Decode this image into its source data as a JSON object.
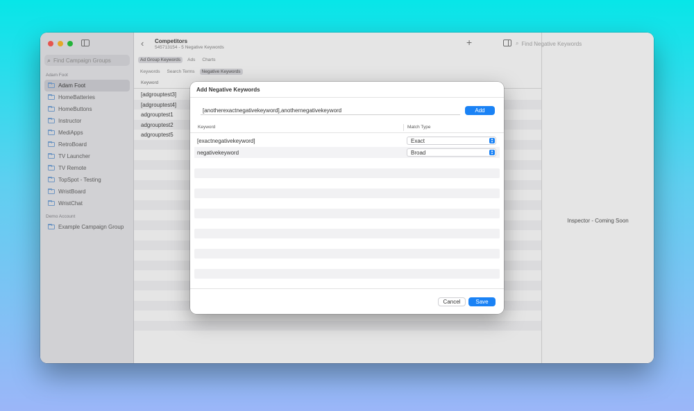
{
  "sidebar": {
    "search_placeholder": "Find Campaign Groups",
    "sections": [
      {
        "title": "Adam Foot",
        "items": [
          "Adam Foot",
          "HomeBatteries",
          "HomeButtons",
          "Instructor",
          "MediApps",
          "RetroBoard",
          "TV Launcher",
          "TV Remote",
          "TopSpot - Testing",
          "WristBoard",
          "WristChat"
        ]
      },
      {
        "title": "Demo Account",
        "items": [
          "Example Campaign Group"
        ]
      }
    ]
  },
  "header": {
    "title": "Competitors",
    "subtitle": "545713154 - 5 Negative Keywords",
    "search_placeholder": "Find Negative Keywords"
  },
  "segments": {
    "row1": [
      "Ad Group Keywords",
      "Ads",
      "Charts"
    ],
    "row2": [
      "Keywords",
      "Search Terms",
      "Negative Keywords"
    ]
  },
  "table": {
    "column_keyword": "Keyword",
    "rows": [
      {
        "keyword": "[adgrouptest3]",
        "right": "up"
      },
      {
        "keyword": "[adgrouptest4]",
        "right": "up"
      },
      {
        "keyword": "adgrouptest1",
        "right": "up"
      },
      {
        "keyword": "adgrouptest2",
        "right": "up"
      },
      {
        "keyword": "adgrouptest5",
        "right": "up"
      }
    ]
  },
  "inspector": {
    "text": "Inspector - Coming Soon"
  },
  "dialog": {
    "title": "Add Negative Keywords",
    "input_value": "[anotherexactnegativekeyword],anothernegativekeyword",
    "add_label": "Add",
    "col_keyword": "Keyword",
    "col_match_type": "Match Type",
    "rows": [
      {
        "keyword": "[exactnegativekeyword]",
        "match_type": "Exact"
      },
      {
        "keyword": "negativekeyword",
        "match_type": "Broad"
      }
    ],
    "cancel_label": "Cancel",
    "save_label": "Save"
  },
  "colors": {
    "accent": "#1a82f5"
  }
}
